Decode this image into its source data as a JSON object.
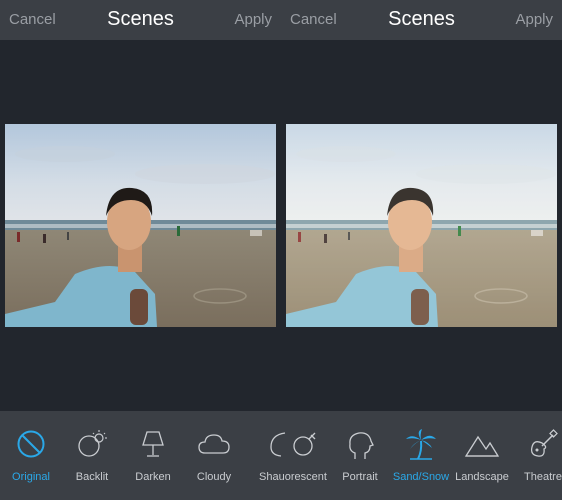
{
  "left_panel": {
    "cancel": "Cancel",
    "title": "Scenes",
    "apply": "Apply"
  },
  "right_panel": {
    "cancel": "Cancel",
    "title": "Scenes",
    "apply": "Apply"
  },
  "colors": {
    "accent": "#2aa8e8",
    "bar": "#3b3f45",
    "background": "#22262d"
  },
  "photos": {
    "left": {
      "description_icon": "beach-selfie-photo",
      "filter": "Original"
    },
    "right": {
      "description_icon": "beach-selfie-photo",
      "filter": "Sand/Snow"
    }
  },
  "scenes": [
    {
      "label": "Original",
      "icon": "no-filter-icon",
      "active": true
    },
    {
      "label": "Backlit",
      "icon": "backlit-icon",
      "active": false
    },
    {
      "label": "Darken",
      "icon": "lamp-icon",
      "active": false
    },
    {
      "label": "Cloudy",
      "icon": "cloud-icon",
      "active": false
    },
    {
      "label": "Shauorescent",
      "icon": "fluorescent-icon",
      "active": false
    },
    {
      "label": "Portrait",
      "icon": "portrait-icon",
      "active": false
    },
    {
      "label": "Sand/Snow",
      "icon": "palm-tree-icon",
      "active": true
    },
    {
      "label": "Landscape",
      "icon": "mountain-icon",
      "active": false
    },
    {
      "label": "Theatre",
      "icon": "guitar-icon",
      "active": false
    }
  ]
}
